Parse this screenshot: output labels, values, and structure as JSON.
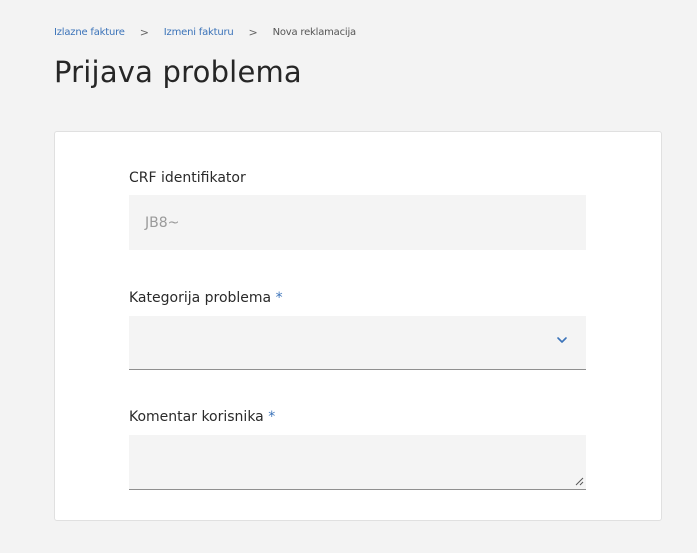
{
  "breadcrumb": {
    "items": [
      {
        "label": "Izlazne fakture"
      },
      {
        "label": "Izmeni fakturu"
      },
      {
        "label": "Nova reklamacija"
      }
    ],
    "separator": ">"
  },
  "page": {
    "title": "Prijava problema"
  },
  "form": {
    "crf": {
      "label": "CRF identifikator",
      "value": "JB8~"
    },
    "category": {
      "label": "Kategorija problema",
      "required_mark": "*",
      "value": ""
    },
    "comment": {
      "label": "Komentar korisnika",
      "required_mark": "*",
      "value": ""
    }
  },
  "colors": {
    "accent": "#3b73b9",
    "background": "#f3f3f3",
    "field_bg": "#f4f4f4"
  },
  "icons": {
    "select": "chevron-down-icon",
    "textarea": "resize-handle-icon"
  }
}
